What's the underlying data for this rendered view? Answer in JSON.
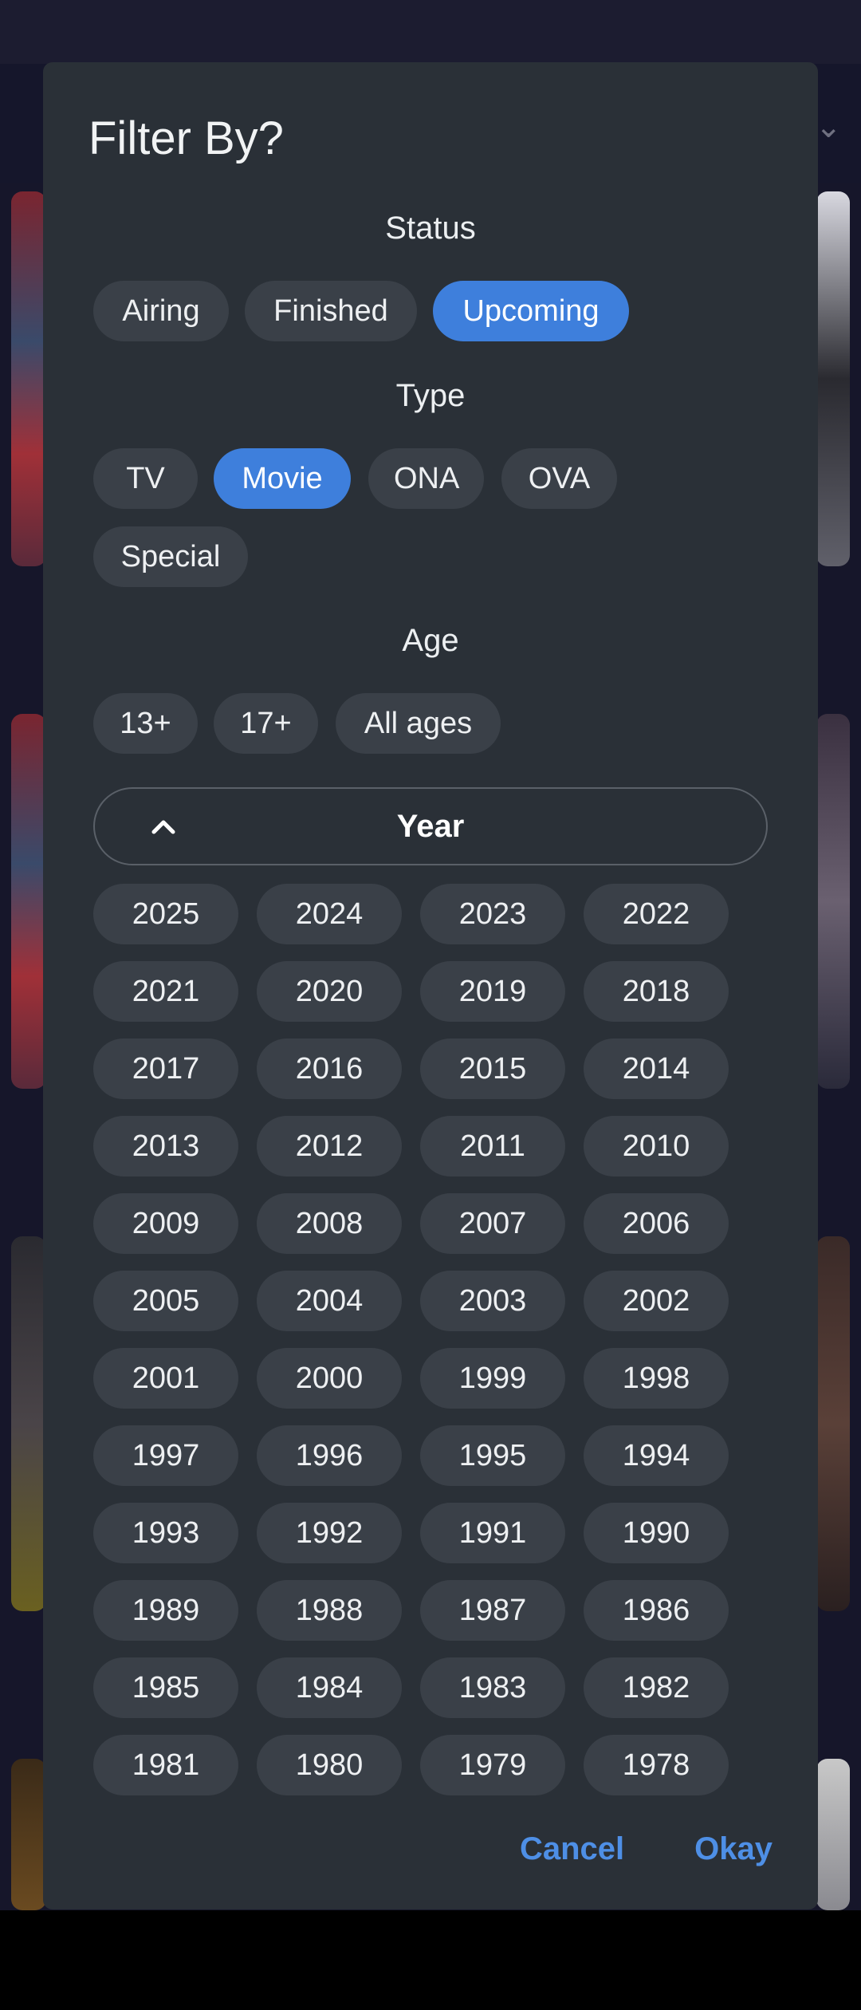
{
  "dialog": {
    "title": "Filter By?",
    "sections": {
      "status": {
        "label": "Status",
        "options": [
          "Airing",
          "Finished",
          "Upcoming"
        ],
        "selected": "Upcoming"
      },
      "type": {
        "label": "Type",
        "options": [
          "TV",
          "Movie",
          "ONA",
          "OVA",
          "Special"
        ],
        "selected": "Movie"
      },
      "age": {
        "label": "Age",
        "options": [
          "13+",
          "17+",
          "All ages"
        ],
        "selected": null
      }
    },
    "year": {
      "label": "Year",
      "expanded": true,
      "icon": "chevron-up-icon",
      "options": [
        "2025",
        "2024",
        "2023",
        "2022",
        "2021",
        "2020",
        "2019",
        "2018",
        "2017",
        "2016",
        "2015",
        "2014",
        "2013",
        "2012",
        "2011",
        "2010",
        "2009",
        "2008",
        "2007",
        "2006",
        "2005",
        "2004",
        "2003",
        "2002",
        "2001",
        "2000",
        "1999",
        "1998",
        "1997",
        "1996",
        "1995",
        "1994",
        "1993",
        "1992",
        "1991",
        "1990",
        "1989",
        "1988",
        "1987",
        "1986",
        "1985",
        "1984",
        "1983",
        "1982",
        "1981",
        "1980",
        "1979",
        "1978"
      ]
    },
    "actions": {
      "cancel": "Cancel",
      "okay": "Okay"
    }
  },
  "colors": {
    "dialog_bg": "#2a3037",
    "chip_bg": "#3a4048",
    "chip_selected": "#3e7fdc",
    "action_text": "#4e8fe6",
    "scrim": "#16162a"
  }
}
